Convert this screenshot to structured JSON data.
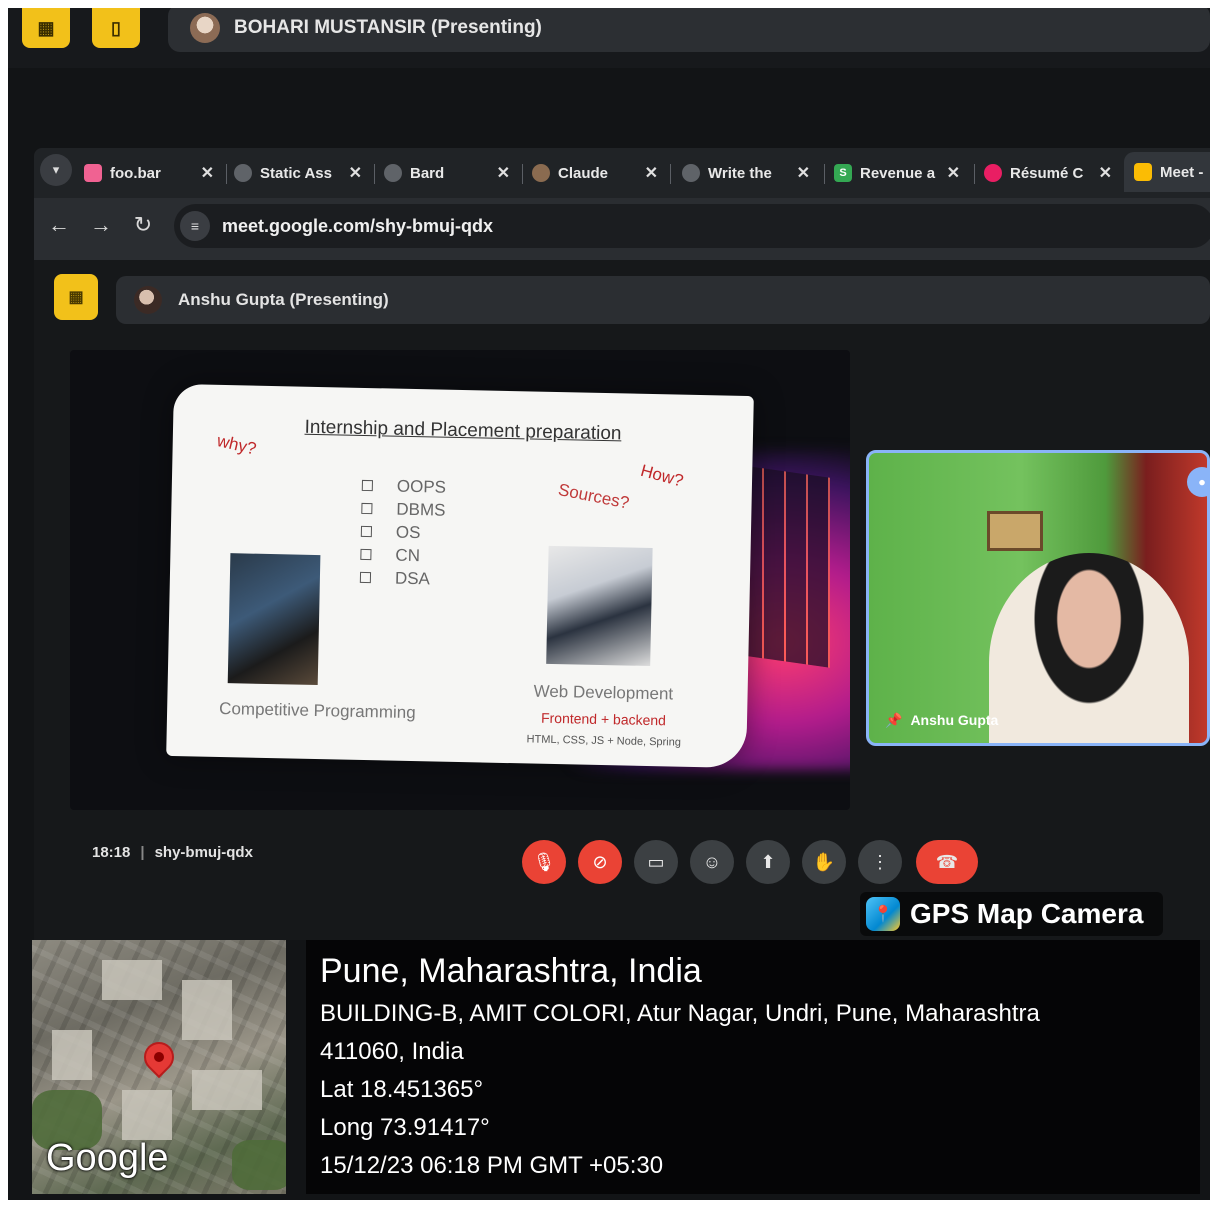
{
  "outer_meet": {
    "presenter": "BOHARI MUSTANSIR (Presenting)"
  },
  "browser": {
    "tabs": [
      {
        "label": "foo.bar",
        "color": "#f06292"
      },
      {
        "label": "Static Ass",
        "color": "#9e9e9e"
      },
      {
        "label": "Bard",
        "color": "#9e9e9e"
      },
      {
        "label": "Claude",
        "color": "#9e9e9e"
      },
      {
        "label": "Write the",
        "color": "#9e9e9e"
      },
      {
        "label": "Revenue a",
        "color": "#34a853"
      },
      {
        "label": "Résumé C",
        "color": "#e91e63"
      },
      {
        "label": "Meet -",
        "color": "#fbbc04"
      }
    ],
    "url": "meet.google.com/shy-bmuj-qdx"
  },
  "inner_meet": {
    "presenter": "Anshu Gupta (Presenting)",
    "participant_name": "Anshu Gupta",
    "time": "18:18",
    "meeting_code": "shy-bmuj-qdx"
  },
  "slide": {
    "title": "Internship and Placement preparation",
    "why": "why?",
    "how": "How?",
    "sources": "Sources?",
    "topics": [
      "OOPS",
      "DBMS",
      "OS",
      "CN",
      "DSA"
    ],
    "left_caption": "Competitive Programming",
    "right_caption": "Web Development",
    "right_sub": "Frontend + backend",
    "right_tiny": "HTML, CSS, JS + Node, Spring"
  },
  "gps": {
    "app_name": "GPS Map Camera",
    "city": "Pune, Maharashtra, India",
    "address_line1": "BUILDING-B, AMIT COLORI, Atur Nagar, Undri, Pune, Maharashtra",
    "address_line2": "411060, India",
    "lat": "Lat 18.451365°",
    "long": "Long 73.91417°",
    "datetime": "15/12/23 06:18 PM GMT +05:30",
    "map_brand": "Google"
  },
  "colors": {
    "accent_yellow": "#f2c11a",
    "meet_red": "#ea4335",
    "tile_border": "#8ab4f8"
  }
}
